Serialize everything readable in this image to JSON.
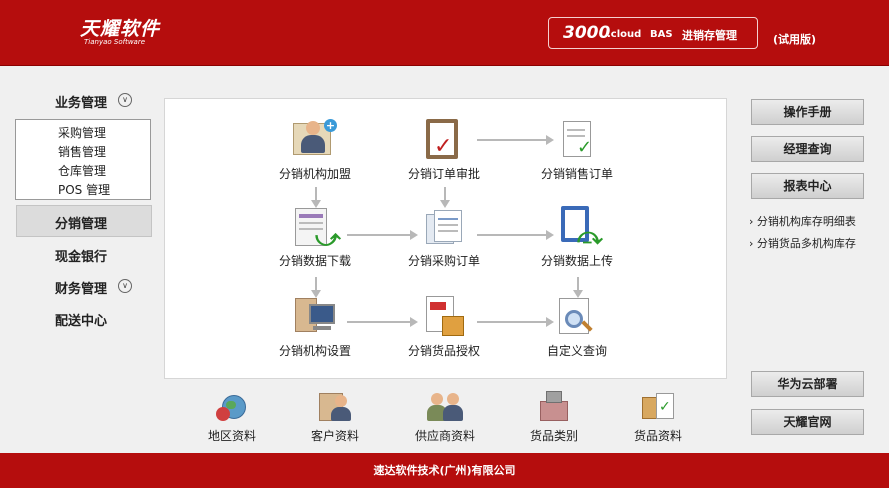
{
  "header": {
    "logo_cn": "天耀软件",
    "logo_en": "Tianyao Software",
    "edition_number": "3000",
    "edition_cloud": ".cloud",
    "edition_bas": "BAS",
    "edition_title": "进销存管理",
    "trial_label": "(试用版)"
  },
  "sidebar": {
    "business": "业务管理",
    "sub_items": [
      "采购管理",
      "销售管理",
      "仓库管理",
      "POS 管理"
    ],
    "distribution": "分销管理",
    "cash_bank": "现金银行",
    "finance": "财务管理",
    "delivery": "配送中心"
  },
  "workflow": {
    "nodes": [
      {
        "label": "分销机构加盟",
        "icon": "user-add-icon"
      },
      {
        "label": "分销订单审批",
        "icon": "clipboard-check-icon"
      },
      {
        "label": "分销销售订单",
        "icon": "document-check-icon"
      },
      {
        "label": "分销数据下载",
        "icon": "data-download-icon"
      },
      {
        "label": "分销采购订单",
        "icon": "documents-icon"
      },
      {
        "label": "分销数据上传",
        "icon": "data-upload-icon"
      },
      {
        "label": "分销机构设置",
        "icon": "computer-settings-icon"
      },
      {
        "label": "分销货品授权",
        "icon": "product-authorize-icon"
      },
      {
        "label": "自定义查询",
        "icon": "magnifier-query-icon"
      }
    ]
  },
  "right_panel": {
    "buttons": [
      "操作手册",
      "经理查询",
      "报表中心"
    ],
    "links": [
      "分销机构库存明细表",
      "分销货品多机构库存"
    ],
    "bottom_buttons": [
      "华为云部署",
      "天耀官网"
    ]
  },
  "bottom_bar": {
    "items": [
      {
        "label": "地区资料",
        "icon": "globe-icon"
      },
      {
        "label": "客户资料",
        "icon": "customer-icon"
      },
      {
        "label": "供应商资料",
        "icon": "supplier-icon"
      },
      {
        "label": "货品类别",
        "icon": "product-category-icon"
      },
      {
        "label": "货品资料",
        "icon": "product-info-icon"
      }
    ]
  },
  "footer": {
    "company": "速达软件技术(广州)有限公司"
  },
  "colors": {
    "brand_red": "#b50d0d",
    "background": "#f0f0f0",
    "panel": "#ffffff"
  }
}
